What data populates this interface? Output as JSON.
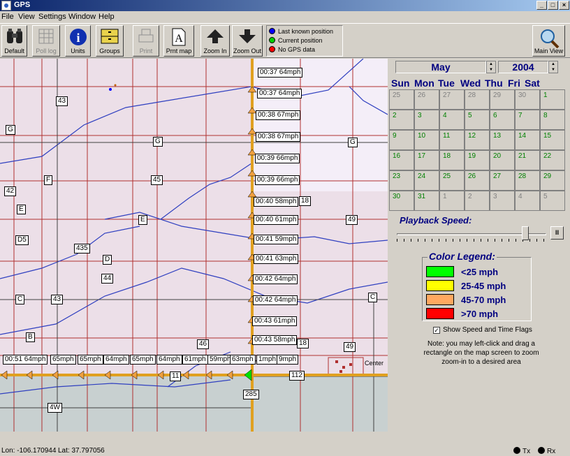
{
  "window": {
    "title": "GPS"
  },
  "menu": [
    "File",
    "View",
    "Settings",
    "Window",
    "Help"
  ],
  "toolbar": {
    "default": "Default",
    "poll_log": "Poll log",
    "units": "Units",
    "groups": "Groups",
    "print": "Print",
    "print_map": "Prnt map",
    "zoom_in": "Zoom In",
    "zoom_out": "Zoom Out",
    "main_view": "Main View"
  },
  "gps_legend": [
    {
      "label": "Last known position",
      "color": "#0000ff"
    },
    {
      "label": "Current position",
      "color": "#00d000"
    },
    {
      "label": "No GPS data",
      "color": "#ff0000"
    }
  ],
  "map": {
    "road_labels": [
      "43",
      "G",
      "G",
      "G",
      "42",
      "F",
      "45",
      "E",
      "E",
      "D5",
      "435",
      "49",
      "D",
      "44",
      "C",
      "43",
      "C",
      "B",
      "46",
      "49",
      "112",
      "285",
      "4W",
      "11",
      "18",
      "18",
      "Center"
    ],
    "flags_vertical": [
      "00:37 64mph",
      "00:37 64mph",
      "00:38 67mph",
      "00:38 67mph",
      "00:39 66mph",
      "00:39 66mph",
      "00:40 58mph",
      "00:40 61mph",
      "00:41 59mph",
      "00:41 63mph",
      "00:42 64mph",
      "00:42 64mph",
      "00:43 61mph",
      "00:43 58mph"
    ],
    "flags_horizontal": [
      "00:51 64mph",
      "65mph",
      "65mph",
      "64mph",
      "65mph",
      "64mph",
      "61mph",
      "59mph",
      "63mph",
      "1mph",
      "9mph"
    ]
  },
  "calendar": {
    "month": "May",
    "year": "2004",
    "days_of_week": [
      "Sun",
      "Mon",
      "Tue",
      "Wed",
      "Thu",
      "Fri",
      "Sat"
    ],
    "weeks": [
      [
        {
          "d": "25",
          "o": true
        },
        {
          "d": "26",
          "o": true
        },
        {
          "d": "27",
          "o": true
        },
        {
          "d": "28",
          "o": true
        },
        {
          "d": "29",
          "o": true
        },
        {
          "d": "30",
          "o": true
        },
        {
          "d": "1",
          "o": false
        }
      ],
      [
        {
          "d": "2",
          "o": false
        },
        {
          "d": "3",
          "o": false
        },
        {
          "d": "4",
          "o": false
        },
        {
          "d": "5",
          "o": false
        },
        {
          "d": "6",
          "o": false
        },
        {
          "d": "7",
          "o": false
        },
        {
          "d": "8",
          "o": false
        }
      ],
      [
        {
          "d": "9",
          "o": false
        },
        {
          "d": "10",
          "o": false
        },
        {
          "d": "11",
          "o": false
        },
        {
          "d": "12",
          "o": false
        },
        {
          "d": "13",
          "o": false
        },
        {
          "d": "14",
          "o": false
        },
        {
          "d": "15",
          "o": false
        }
      ],
      [
        {
          "d": "16",
          "o": false
        },
        {
          "d": "17",
          "o": false
        },
        {
          "d": "18",
          "o": false
        },
        {
          "d": "19",
          "o": false
        },
        {
          "d": "20",
          "o": false
        },
        {
          "d": "21",
          "o": false
        },
        {
          "d": "22",
          "o": false
        }
      ],
      [
        {
          "d": "23",
          "o": false
        },
        {
          "d": "24",
          "o": false
        },
        {
          "d": "25",
          "o": false
        },
        {
          "d": "26",
          "o": false
        },
        {
          "d": "27",
          "o": false
        },
        {
          "d": "28",
          "o": false
        },
        {
          "d": "29",
          "o": false
        }
      ],
      [
        {
          "d": "30",
          "o": false
        },
        {
          "d": "31",
          "o": false
        },
        {
          "d": "1",
          "o": true
        },
        {
          "d": "2",
          "o": true
        },
        {
          "d": "3",
          "o": true
        },
        {
          "d": "4",
          "o": true
        },
        {
          "d": "5",
          "o": true
        }
      ]
    ]
  },
  "playback": {
    "label": "Playback Speed:",
    "pause": "II",
    "level": 0.9
  },
  "color_legend": {
    "title": "Color Legend:",
    "items": [
      {
        "label": "<25 mph",
        "color": "#00ff00"
      },
      {
        "label": "25-45 mph",
        "color": "#ffff00"
      },
      {
        "label": "45-70 mph",
        "color": "#ffa860"
      },
      {
        "label": ">70 mph",
        "color": "#ff0000"
      }
    ]
  },
  "options": {
    "show_flags_label": "Show Speed and Time Flags",
    "show_flags_checked": true,
    "note": "Note: you may left-click and drag a rectangle on the map screen to zoom zoom-in to a desired area"
  },
  "status": {
    "lon": "Lon: -106.170944",
    "lat": "Lat: 37.797056",
    "tx": "Tx",
    "rx": "Rx"
  }
}
